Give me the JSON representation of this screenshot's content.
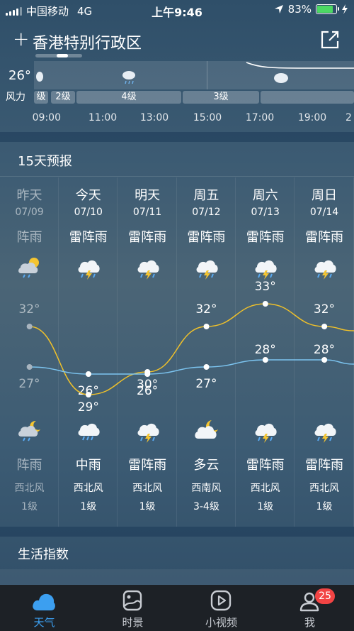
{
  "status_bar": {
    "carrier": "中国移动",
    "network": "4G",
    "time": "上午9:46",
    "battery_text": "83%",
    "battery_level": 0.83,
    "battery_color": "#4cd964"
  },
  "header": {
    "add_symbol": "+",
    "city": "香港特别行政区",
    "share_icon": "share-external-icon"
  },
  "hourly": {
    "current_temp": "26°",
    "wind_label": "风力",
    "wind_levels": [
      "级",
      "2级",
      "4级",
      "3级"
    ],
    "times": [
      "09:00",
      "11:00",
      "13:00",
      "15:00",
      "17:00",
      "19:00",
      "2"
    ]
  },
  "forecast": {
    "title": "15天预报",
    "days": [
      {
        "day": "昨天",
        "date": "07/09",
        "cond_day": "阵雨",
        "icon_day": "shower-sun-icon",
        "high": "32°",
        "low": "27°",
        "icon_night": "shower-moon-icon",
        "cond_night": "阵雨",
        "wind_dir": "西北风",
        "wind_level": "1级",
        "past": true
      },
      {
        "day": "今天",
        "date": "07/10",
        "cond_day": "雷阵雨",
        "icon_day": "thunderstorm-icon",
        "high": "29°",
        "low": "26°",
        "icon_night": "rain-icon",
        "cond_night": "中雨",
        "wind_dir": "西北风",
        "wind_level": "1级",
        "past": false
      },
      {
        "day": "明天",
        "date": "07/11",
        "cond_day": "雷阵雨",
        "icon_day": "thunderstorm-icon",
        "high": "30°",
        "low": "26°",
        "icon_night": "thunderstorm-icon",
        "cond_night": "雷阵雨",
        "wind_dir": "西北风",
        "wind_level": "1级",
        "past": false
      },
      {
        "day": "周五",
        "date": "07/12",
        "cond_day": "雷阵雨",
        "icon_day": "thunderstorm-icon",
        "high": "32°",
        "low": "27°",
        "icon_night": "cloudy-moon-icon",
        "cond_night": "多云",
        "wind_dir": "西南风",
        "wind_level": "3-4级",
        "past": false
      },
      {
        "day": "周六",
        "date": "07/13",
        "cond_day": "雷阵雨",
        "icon_day": "thunderstorm-icon",
        "high": "33°",
        "low": "28°",
        "icon_night": "thunderstorm-icon",
        "cond_night": "雷阵雨",
        "wind_dir": "西北风",
        "wind_level": "1级",
        "past": false
      },
      {
        "day": "周日",
        "date": "07/14",
        "cond_day": "雷阵雨",
        "icon_day": "thunderstorm-icon",
        "high": "32°",
        "low": "28°",
        "icon_night": "thunderstorm-icon",
        "cond_night": "雷阵雨",
        "wind_dir": "西北风",
        "wind_level": "1级",
        "past": false
      }
    ],
    "chart_colors": {
      "high": "#f0c12a",
      "low": "#7cc4f0"
    }
  },
  "life_index": {
    "title": "生活指数"
  },
  "tabbar": {
    "tabs": [
      {
        "label": "天气",
        "icon": "weather-cloud-icon",
        "active": true
      },
      {
        "label": "时景",
        "icon": "photo-scene-icon",
        "active": false
      },
      {
        "label": "小视频",
        "icon": "video-play-icon",
        "active": false
      },
      {
        "label": "我",
        "icon": "profile-icon",
        "active": false,
        "badge": "25"
      }
    ],
    "active_color": "#3c9ff0"
  }
}
